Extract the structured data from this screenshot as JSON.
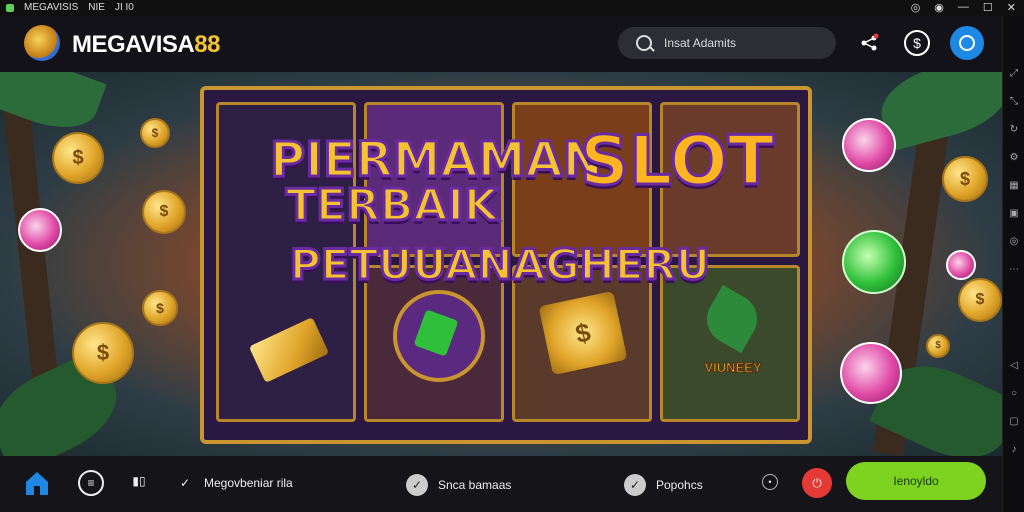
{
  "window": {
    "title": "MEGAVISIS",
    "title_extra1": "NIE",
    "title_extra2": "JI I0",
    "controls": [
      "◎",
      "◉",
      "—",
      "☐",
      "✕"
    ]
  },
  "header": {
    "logo_main": "MEGAVISA",
    "logo_accent": "88",
    "search_placeholder": "Insat Adamits"
  },
  "hero": {
    "line1": "PIERMAMAN",
    "line1b": "SLOT",
    "line2": "TERBAIK",
    "line3": "PETUUANAGHERU",
    "symbol_label": "VIUNEEY"
  },
  "bottom": {
    "item1": "Megovbeniar rila",
    "item2": "Snca bamaas",
    "item3": "Popohcs",
    "cta": "Ienoyldo"
  },
  "colors": {
    "accent": "#f5c431",
    "cta": "#7ed321",
    "nav_blue": "#1e88e5",
    "red": "#e53935"
  }
}
